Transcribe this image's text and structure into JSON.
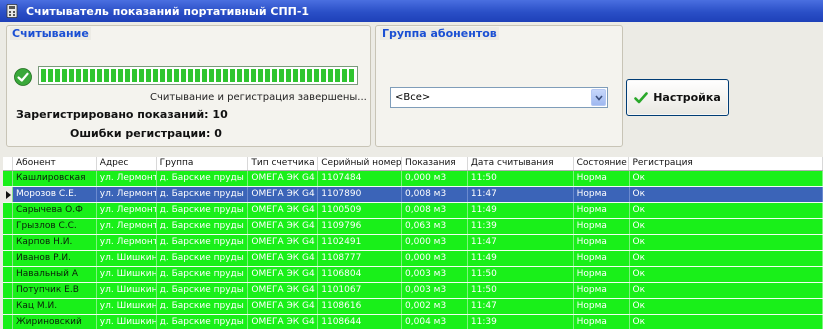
{
  "window": {
    "title": "Считыватель показаний портативный СПП-1"
  },
  "reading": {
    "legend": "Считывание",
    "progress": 1.0,
    "status": "Считывание и регистрация завершены...",
    "registered": "Зарегистрировано показаний: 10",
    "errors": "Ошибки регистрации: 0"
  },
  "group": {
    "legend": "Группа абонентов",
    "selected": "<Все>"
  },
  "settings": {
    "label": "Настройка"
  },
  "colors": {
    "row_ok": "#19f019",
    "row_selected": "#3b64b8",
    "accent": "#1a4fd3"
  },
  "table": {
    "columns": [
      "Абонент",
      "Адрес",
      "Группа",
      "Тип счетчика",
      "Серийный номер",
      "Показания",
      "Дата считывания",
      "Состояние",
      "Регистрация"
    ],
    "rows": [
      [
        "Кашлировская",
        "ул. Лермонто",
        "д. Барские пруды",
        "ОМЕГА ЭК G4",
        "1107484",
        "0,000 м3",
        "11:50",
        "Норма",
        "Ок"
      ],
      [
        "Морозов С.Е.",
        "ул. Лермонто",
        "д. Барские пруды",
        "ОМЕГА ЭК G4",
        "1107890",
        "0,008 м3",
        "11:47",
        "Норма",
        "Ок"
      ],
      [
        "Сарычева О.Ф",
        "ул. Лермонто",
        "д. Барские пруды",
        "ОМЕГА ЭК G4",
        "1100509",
        "0,008 м3",
        "11:49",
        "Норма",
        "Ок"
      ],
      [
        "Грызлов С.С.",
        "ул. Лермонто",
        "д. Барские пруды",
        "ОМЕГА ЭК G4",
        "1109796",
        "0,063 м3",
        "11:39",
        "Норма",
        "Ок"
      ],
      [
        "Карпов Н.И.",
        "ул. Лермонто",
        "д. Барские пруды",
        "ОМЕГА ЭК G4",
        "1102491",
        "0,000 м3",
        "11:47",
        "Норма",
        "Ок"
      ],
      [
        "Иванов Р.И.",
        "ул. Шишкина",
        "д. Барские пруды",
        "ОМЕГА ЭК G4",
        "1108777",
        "0,000 м3",
        "11:49",
        "Норма",
        "Ок"
      ],
      [
        "Навальный А",
        "ул. Шишкина",
        "д. Барские пруды",
        "ОМЕГА ЭК G4",
        "1106804",
        "0,003 м3",
        "11:50",
        "Норма",
        "Ок"
      ],
      [
        "Потупчик Е.В",
        "ул. Шишкина",
        "д. Барские пруды",
        "ОМЕГА ЭК G4",
        "1101067",
        "0,003 м3",
        "11:50",
        "Норма",
        "Ок"
      ],
      [
        "Кац М.И.",
        "ул. Шишкина",
        "д. Барские пруды",
        "ОМЕГА ЭК G4",
        "1108616",
        "0,002 м3",
        "11:47",
        "Норма",
        "Ок"
      ],
      [
        "Жириновский",
        "ул. Шишкина",
        "д. Барские пруды",
        "ОМЕГА ЭК G4",
        "1108644",
        "0,004 м3",
        "11:39",
        "Норма",
        "Ок"
      ]
    ],
    "selected_row": 1
  }
}
